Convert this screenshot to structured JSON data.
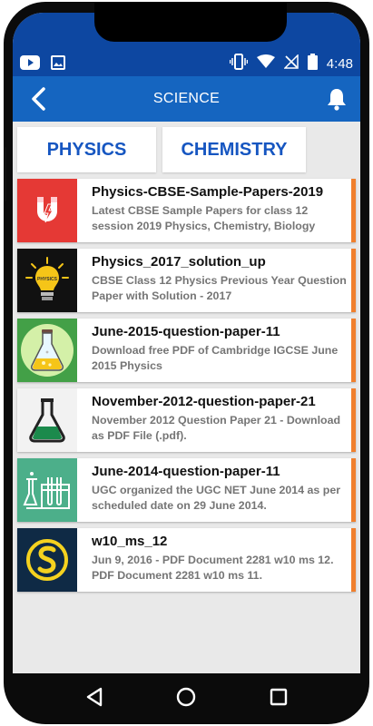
{
  "status_bar": {
    "time": "4:48",
    "left_icons": [
      "youtube-icon",
      "image-icon"
    ],
    "right_icons": [
      "vibrate-icon",
      "wifi-icon",
      "no-signal-icon",
      "battery-icon"
    ]
  },
  "app_bar": {
    "title": "SCIENCE",
    "back_icon": "chevron-left-icon",
    "notification_icon": "bell-icon"
  },
  "tabs": [
    {
      "label": "PHYSICS"
    },
    {
      "label": "CHEMISTRY"
    }
  ],
  "items": [
    {
      "title": "Physics-CBSE-Sample-Papers-2019",
      "description": "Latest CBSE Sample Papers for class 12 session 2019 Physics, Chemistry, Biology",
      "thumb_icon": "magnet-icon",
      "thumb_bg": "#e53935"
    },
    {
      "title": "Physics_2017_solution_up",
      "description": "CBSE Class 12 Physics Previous Year Question Paper with Solution - 2017",
      "thumb_icon": "lightbulb-icon",
      "thumb_bg": "#111111",
      "thumb_text": "PHYSICS"
    },
    {
      "title": "June-2015-question-paper-11",
      "description": "Download free PDF of Cambridge IGCSE June 2015 Physics",
      "thumb_icon": "flask-icon",
      "thumb_bg": "#43a047"
    },
    {
      "title": "November-2012-question-paper-21",
      "description": "November 2012 Question Paper 21 - Download as PDF File (.pdf).",
      "thumb_icon": "erlenmeyer-flask-icon",
      "thumb_bg": "#f2f2f2"
    },
    {
      "title": "June-2014-question-paper-11",
      "description": "UGC organized the UGC NET June 2014 as per scheduled date on 29 June 2014.",
      "thumb_icon": "test-tubes-icon",
      "thumb_bg": "#4caf8a"
    },
    {
      "title": "w10_ms_12",
      "description": "Jun 9, 2016 - PDF Document 2281 w10 ms 12. PDF Document 2281 w10 ms 11.",
      "thumb_icon": "s-logo-icon",
      "thumb_bg": "#0f2a45"
    }
  ],
  "colors": {
    "status_bar": "#0d47a1",
    "app_bar": "#1565c0",
    "tab_text": "#1656c1",
    "accent": "#f07f2d",
    "background": "#e9e9e9"
  },
  "nav_bar": [
    "back-icon",
    "home-icon",
    "recents-icon"
  ]
}
